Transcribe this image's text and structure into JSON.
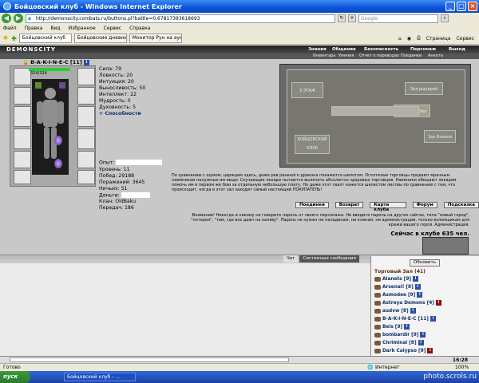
{
  "window": {
    "title": "Бойцовский клуб - Windows Internet Explorer"
  },
  "address": {
    "url": "http://demonscity.combats.ru/buttons.pl?battle=0.67817393618693",
    "search_placeholder": "Google"
  },
  "menu": [
    "Файл",
    "Правка",
    "Вид",
    "Избранное",
    "Сервис",
    "Справка"
  ],
  "tabs": [
    "Бойцовский клуб",
    "Бойцовские дневники - В-А...",
    "Монитор Рун на аукционе ..."
  ],
  "toolbar": {
    "page": "Страница",
    "tools": "Сервис"
  },
  "site": {
    "logo": "DEMONSCITY",
    "nav": [
      "Знания",
      "Общение",
      "Безопасность",
      "Персонаж",
      "Выход"
    ],
    "subnav": [
      "Инвентарь",
      "Умения",
      "Отчет о переводах",
      "Поединки",
      "Анкета"
    ]
  },
  "character": {
    "name": "B-A-K-I-N-E-C",
    "level": "[11]",
    "hp": "324/324",
    "stats": [
      {
        "label": "Сила: 79"
      },
      {
        "label": "Ловкость: 20"
      },
      {
        "label": "Интуиция: 20"
      },
      {
        "label": "Выносливость: 50"
      },
      {
        "label": "Интеллект: 22"
      },
      {
        "label": "Мудрость: 0"
      },
      {
        "label": "Духовность: 5"
      }
    ],
    "abilities": "+ Способности",
    "info": [
      {
        "label": "Опыт:"
      },
      {
        "label": "Уровень: 11"
      },
      {
        "label": "Побед: 29188"
      },
      {
        "label": "Поражений: 3645"
      },
      {
        "label": "Ничьих: 51"
      },
      {
        "label": "Деньги:"
      },
      {
        "label": "Клан: OldBaku"
      },
      {
        "label": "Передач: 186"
      }
    ]
  },
  "map": {
    "zones": [
      "3 ЭТАЖ",
      "БОЙЦОВСКИЙ КЛУБ",
      "Зал рыцарей",
      "Торговый Зал",
      "Зал Воинов"
    ]
  },
  "description": "По сравнению с шумом, царящим здесь, даже рев раненого дракона покажется шепотом. Оголтелые торговцы продают мрачным наемникам ненужные им вещи. Скучающие лекари пытаются вылечить абсолютно здоровых торговцев. Наемники обещают лекарям помочь им в первом же бою за отдельную небольшую плату. Но даже этот гвалт кажется шелестом листвы по сравнению с тем, что происходит, когда в этот зал заходит самый настоящий ПОКУПАТЕЛЬ!",
  "actions": [
    "Поединки",
    "Возврат",
    "Карта клуба",
    "Форум",
    "Подсказка"
  ],
  "warning": "Внимание! Никогда и никому не говорите пароль от своего персонажа. Не вводите пароль на других сайтах, типа \"новый город\", \"лотерея\", \"там, где все дают на халяву\". Пароль не нужен ни паладинам, ни кланам, ни администрации, только взломщикам для кражи вашего героя. Администрация.",
  "online": "Сейчас в клубе 635 чел.",
  "chat": {
    "tabs": [
      "Чат",
      "Системные сообщения"
    ],
    "refresh": "Обновить",
    "room": "Торговый Зал (41)",
    "time": "16:28"
  },
  "users": [
    {
      "name": "Alanets",
      "level": "[9]"
    },
    {
      "name": "Arsenal!",
      "level": "[8]"
    },
    {
      "name": "Asmodee",
      "level": "[9]"
    },
    {
      "name": "Astreya Demons",
      "level": "[4]"
    },
    {
      "name": "audvw",
      "level": "[8]"
    },
    {
      "name": "B-A-K-I-N-E-C",
      "level": "[11]"
    },
    {
      "name": "Beis",
      "level": "[9]"
    },
    {
      "name": "bombardir",
      "level": "[9]"
    },
    {
      "name": "Chriminal",
      "level": "[8]"
    },
    {
      "name": "Dark Calypso",
      "level": "[9]"
    }
  ],
  "statusbar": {
    "left": "Готово",
    "zone": "Интернет",
    "zoom": "100%"
  },
  "taskbar": {
    "start": "пуск",
    "item": "Бойцовский клуб - ...",
    "watermark": "photo.scrols.ru"
  }
}
